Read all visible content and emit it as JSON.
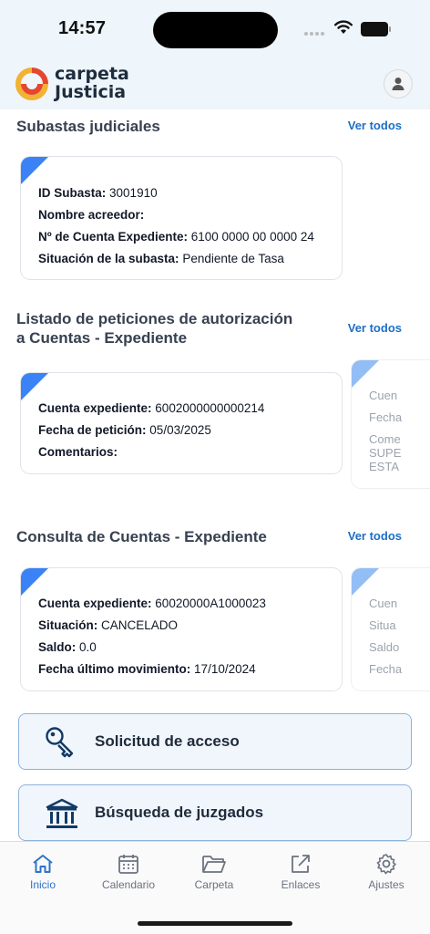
{
  "status_bar": {
    "time": "14:57"
  },
  "header": {
    "brand_line1": "carpeta",
    "brand_line2": "Justicia"
  },
  "colors": {
    "accent": "#1d6fc4",
    "corner": "#3b82f6",
    "header_bg": "#eef5fb"
  },
  "subastas": {
    "title": "Subastas judiciales",
    "see_all": "Ver todos",
    "card": {
      "id_label": "ID Subasta:",
      "id_value": "3001910",
      "acreedor_label": "Nombre acreedor:",
      "acreedor_value": "",
      "cuenta_label": "Nº de Cuenta Expediente:",
      "cuenta_value": "6100 0000 00 0000 24",
      "situacion_label": "Situación de la subasta:",
      "situacion_value": "Pendiente de Tasa"
    }
  },
  "peticiones": {
    "title_line1": "Listado de peticiones de autorización",
    "title_line2": "a Cuentas - Expediente",
    "see_all": "Ver todos",
    "card": {
      "cuenta_label": "Cuenta expediente:",
      "cuenta_value": "6002000000000214",
      "fecha_label": "Fecha de petición:",
      "fecha_value": "05/03/2025",
      "comentarios_label": "Comentarios:",
      "comentarios_value": ""
    },
    "peek": [
      "Cuen",
      "Fecha",
      "Come",
      "SUPE",
      "ESTA"
    ]
  },
  "consulta": {
    "title": "Consulta de Cuentas - Expediente",
    "see_all": "Ver todos",
    "card": {
      "cuenta_label": "Cuenta expediente:",
      "cuenta_value": "60020000A1000023",
      "situacion_label": "Situación:",
      "situacion_value": "CANCELADO",
      "saldo_label": "Saldo:",
      "saldo_value": "0.0",
      "fecha_label": "Fecha último movimiento:",
      "fecha_value": "17/10/2024"
    },
    "peek": [
      "Cuen",
      "Situa",
      "Saldo",
      "Fecha"
    ]
  },
  "actions": {
    "solicitud": "Solicitud de acceso",
    "busqueda": "Búsqueda de juzgados"
  },
  "tabs": [
    {
      "label": "Inicio",
      "icon": "home-icon",
      "active": true
    },
    {
      "label": "Calendario",
      "icon": "calendar-icon",
      "active": false
    },
    {
      "label": "Carpeta",
      "icon": "folder-icon",
      "active": false
    },
    {
      "label": "Enlaces",
      "icon": "external-link-icon",
      "active": false
    },
    {
      "label": "Ajustes",
      "icon": "gear-icon",
      "active": false
    }
  ]
}
